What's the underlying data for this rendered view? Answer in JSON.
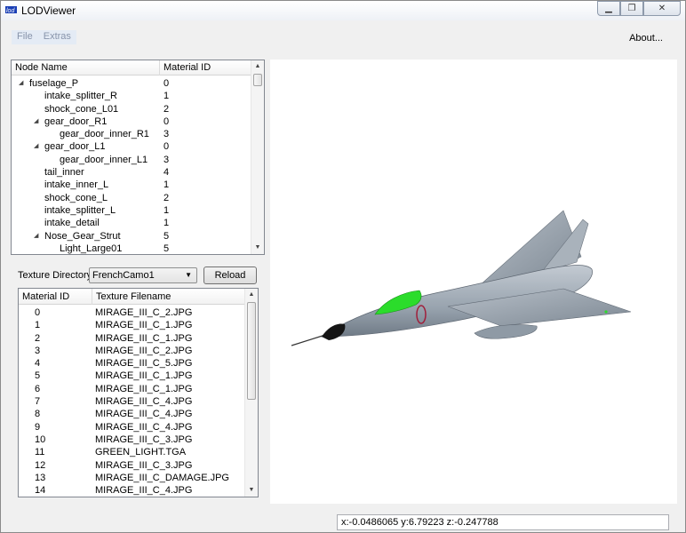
{
  "window": {
    "title": "LODViewer",
    "icon": "lod-app-icon",
    "controls": [
      "minimize-icon",
      "restore-icon",
      "close-icon"
    ]
  },
  "menu": {
    "items": [
      "File",
      "Extras"
    ],
    "about": "About..."
  },
  "tree": {
    "columns": [
      "Node Name",
      "Material ID"
    ],
    "rows": [
      {
        "name": "fuselage_P",
        "id": "0",
        "level": 0,
        "expanded": true
      },
      {
        "name": "intake_splitter_R",
        "id": "1",
        "level": 1
      },
      {
        "name": "shock_cone_L01",
        "id": "2",
        "level": 1
      },
      {
        "name": "gear_door_R1",
        "id": "0",
        "level": 1,
        "expanded": true
      },
      {
        "name": "gear_door_inner_R1",
        "id": "3",
        "level": 2
      },
      {
        "name": "gear_door_L1",
        "id": "0",
        "level": 1,
        "expanded": true
      },
      {
        "name": "gear_door_inner_L1",
        "id": "3",
        "level": 2
      },
      {
        "name": "tail_inner",
        "id": "4",
        "level": 1
      },
      {
        "name": "intake_inner_L",
        "id": "1",
        "level": 1
      },
      {
        "name": "shock_cone_L",
        "id": "2",
        "level": 1
      },
      {
        "name": "intake_splitter_L",
        "id": "1",
        "level": 1
      },
      {
        "name": "intake_detail",
        "id": "1",
        "level": 1
      },
      {
        "name": "Nose_Gear_Strut",
        "id": "5",
        "level": 1,
        "expanded": true
      },
      {
        "name": "Light_Large01",
        "id": "5",
        "level": 2
      }
    ]
  },
  "texture": {
    "label": "Texture Directory:",
    "selected": "FrenchCamo1",
    "reload_label": "Reload"
  },
  "table": {
    "columns": [
      "Material ID",
      "Texture Filename"
    ],
    "rows": [
      {
        "id": "0",
        "file": "MIRAGE_III_C_2.JPG"
      },
      {
        "id": "1",
        "file": "MIRAGE_III_C_1.JPG"
      },
      {
        "id": "2",
        "file": "MIRAGE_III_C_1.JPG"
      },
      {
        "id": "3",
        "file": "MIRAGE_III_C_2.JPG"
      },
      {
        "id": "4",
        "file": "MIRAGE_III_C_5.JPG"
      },
      {
        "id": "5",
        "file": "MIRAGE_III_C_1.JPG"
      },
      {
        "id": "6",
        "file": "MIRAGE_III_C_1.JPG"
      },
      {
        "id": "7",
        "file": "MIRAGE_III_C_4.JPG"
      },
      {
        "id": "8",
        "file": "MIRAGE_III_C_4.JPG"
      },
      {
        "id": "9",
        "file": "MIRAGE_III_C_4.JPG"
      },
      {
        "id": "10",
        "file": "MIRAGE_III_C_3.JPG"
      },
      {
        "id": "11",
        "file": "GREEN_LIGHT.TGA"
      },
      {
        "id": "12",
        "file": "MIRAGE_III_C_3.JPG"
      },
      {
        "id": "13",
        "file": "MIRAGE_III_C_DAMAGE.JPG"
      },
      {
        "id": "14",
        "file": "MIRAGE_III_C_4.JPG"
      }
    ]
  },
  "status": {
    "coords": "x:-0.0486065 y:6.79223 z:-0.247788"
  },
  "colors": {
    "menu_highlight": "#e4ebf5",
    "aircraft_body": "#9aa5b1",
    "canopy": "#2bdc2b",
    "viewport_bg": "#ffffff"
  }
}
